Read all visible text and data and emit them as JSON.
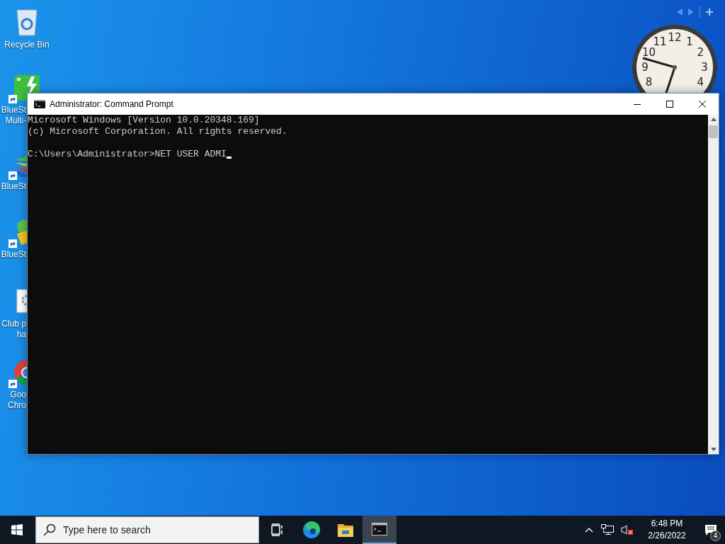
{
  "desktop_icons": [
    {
      "kind": "recycle",
      "shortcut": false,
      "label": [
        "Recycle Bin"
      ]
    },
    {
      "kind": "multi",
      "shortcut": true,
      "label": [
        "BlueSt",
        "Multi-"
      ]
    },
    {
      "kind": "stacks",
      "shortcut": true,
      "label": [
        "BlueSt"
      ]
    },
    {
      "kind": "stacksx",
      "shortcut": true,
      "label": [
        "BlueSt"
      ]
    },
    {
      "kind": "file",
      "shortcut": false,
      "label": [
        "Club p",
        "ha"
      ]
    },
    {
      "kind": "chrome",
      "shortcut": true,
      "label": [
        "Goo",
        "Chro"
      ]
    }
  ],
  "clock_gadget": {
    "numerals": [
      "12",
      "11",
      "1",
      "10",
      "2",
      "9",
      "3",
      "8",
      "4"
    ]
  },
  "window": {
    "title": "Administrator: Command Prompt",
    "output": [
      "Microsoft Windows [Version 10.0.20348.169]",
      "(c) Microsoft Corporation. All rights reserved."
    ],
    "prompt": "C:\\Users\\Administrator>NET USER ADMI",
    "cursor": true
  },
  "taskbar": {
    "search": {
      "placeholder": "Type here to search"
    },
    "apps": [
      {
        "kind": "taskview",
        "selected": false
      },
      {
        "kind": "edge",
        "selected": false
      },
      {
        "kind": "explorer",
        "selected": false
      },
      {
        "kind": "cmd",
        "selected": true
      }
    ],
    "tray": {
      "muted": true,
      "time": "6:48 PM",
      "date": "2/26/2022",
      "notifications": "4"
    }
  }
}
